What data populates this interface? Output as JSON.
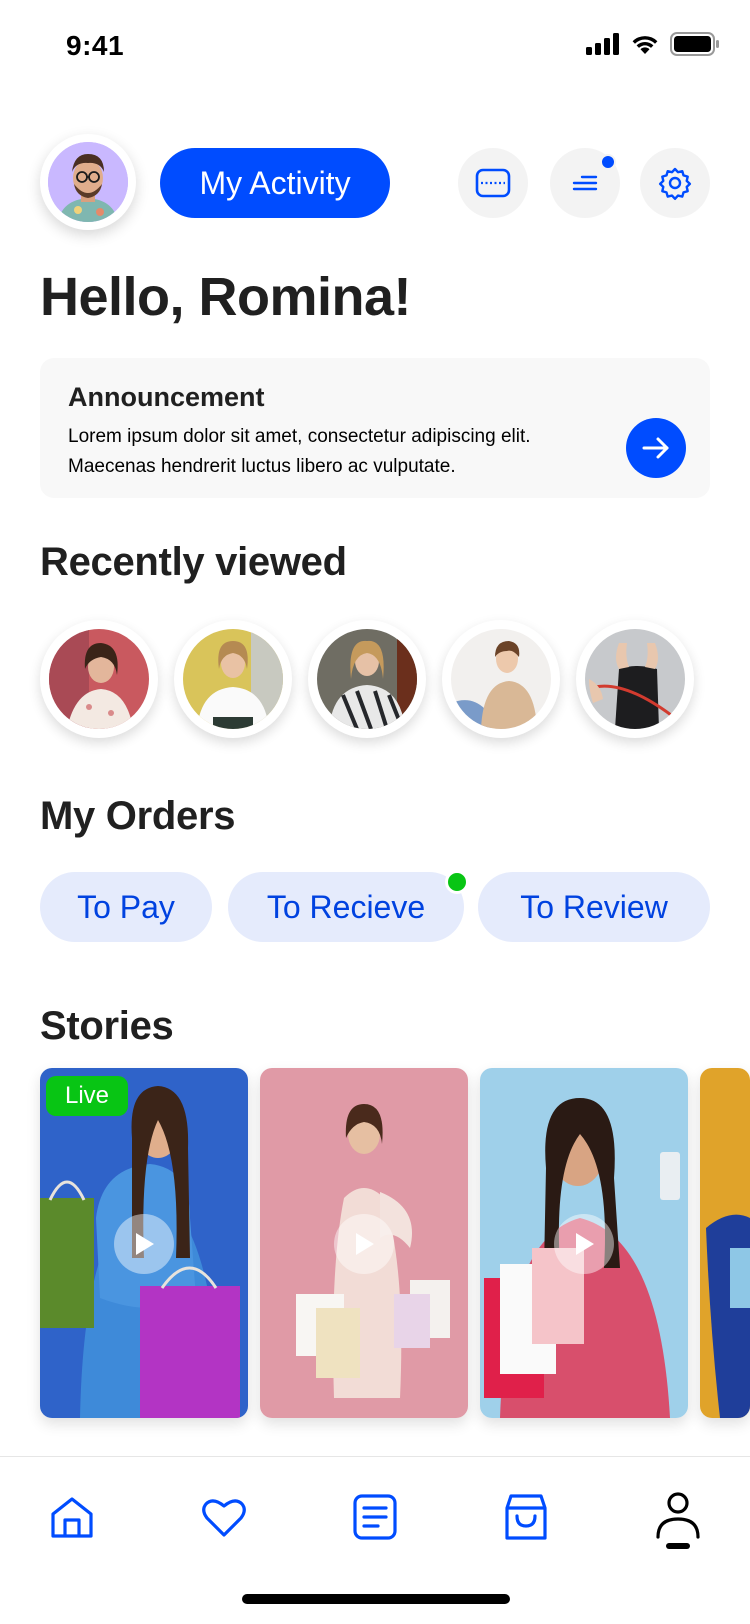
{
  "status_bar": {
    "time": "9:41"
  },
  "header": {
    "activity_button_label": "My Activity",
    "buttons": [
      {
        "icon": "voucher-icon"
      },
      {
        "icon": "menu-lines-icon",
        "has_notification": true
      },
      {
        "icon": "gear-icon"
      }
    ]
  },
  "greeting": "Hello, Romina!",
  "announcement": {
    "title": "Announcement",
    "body": "Lorem ipsum dolor sit amet, consectetur adipiscing elit. Maecenas hendrerit luctus libero ac vulputate."
  },
  "recently_viewed": {
    "title": "Recently viewed",
    "items_count_note": "5 circular product thumbnails"
  },
  "orders": {
    "title": "My Orders",
    "pills": [
      {
        "label": "To Pay"
      },
      {
        "label": "To Recieve",
        "has_indicator": true
      },
      {
        "label": "To Review"
      }
    ]
  },
  "stories": {
    "title": "Stories",
    "live_label": "Live"
  },
  "tab_bar": {
    "tabs": [
      {
        "icon": "home-icon"
      },
      {
        "icon": "heart-icon"
      },
      {
        "icon": "list-icon"
      },
      {
        "icon": "shopping-bag-icon"
      },
      {
        "icon": "profile-icon",
        "active": true
      }
    ]
  },
  "colors": {
    "accent": "#004cff",
    "pill_bg": "#e5ebfc",
    "live_green": "#08c514",
    "text_dark": "#202020"
  }
}
